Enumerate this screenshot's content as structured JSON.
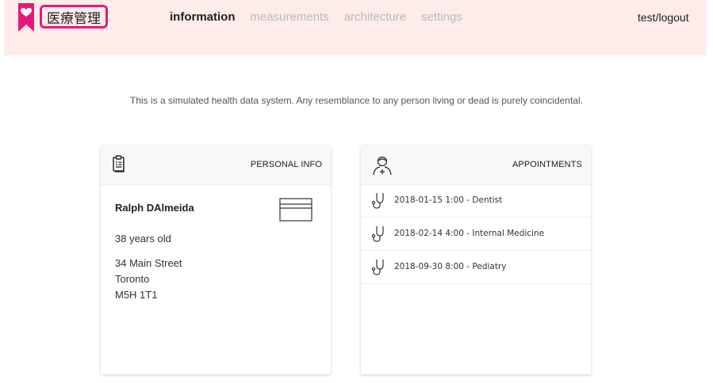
{
  "header": {
    "brand": "医療管理",
    "nav": [
      {
        "label": "information",
        "active": true
      },
      {
        "label": "measurements",
        "active": false
      },
      {
        "label": "architecture",
        "active": false
      },
      {
        "label": "settings",
        "active": false
      }
    ],
    "user_link": "test/logout"
  },
  "disclaimer": "This is a simulated health data system. Any resemblance to any person living or dead is purely coincidental.",
  "personal_info": {
    "title": "PERSONAL INFO",
    "name": "Ralph DAlmeida",
    "age": "38 years old",
    "address": {
      "street": "34 Main Street",
      "city": "Toronto",
      "postal": "M5H 1T1"
    }
  },
  "appointments": {
    "title": "APPOINTMENTS",
    "items": [
      {
        "label": "2018-01-15 1:00 - Dentist"
      },
      {
        "label": "2018-02-14 4:00 - Internal Medicine"
      },
      {
        "label": "2018-09-30 8:00 - Pediatry"
      }
    ]
  },
  "colors": {
    "accent": "#e6197a",
    "header_bg": "#fdecea"
  },
  "icons": {
    "logo": "heart-bookmark-icon",
    "personal_info": "clipboard-icon",
    "id_card": "id-card-icon",
    "appointments": "doctor-icon",
    "appointment_item": "stethoscope-icon"
  }
}
